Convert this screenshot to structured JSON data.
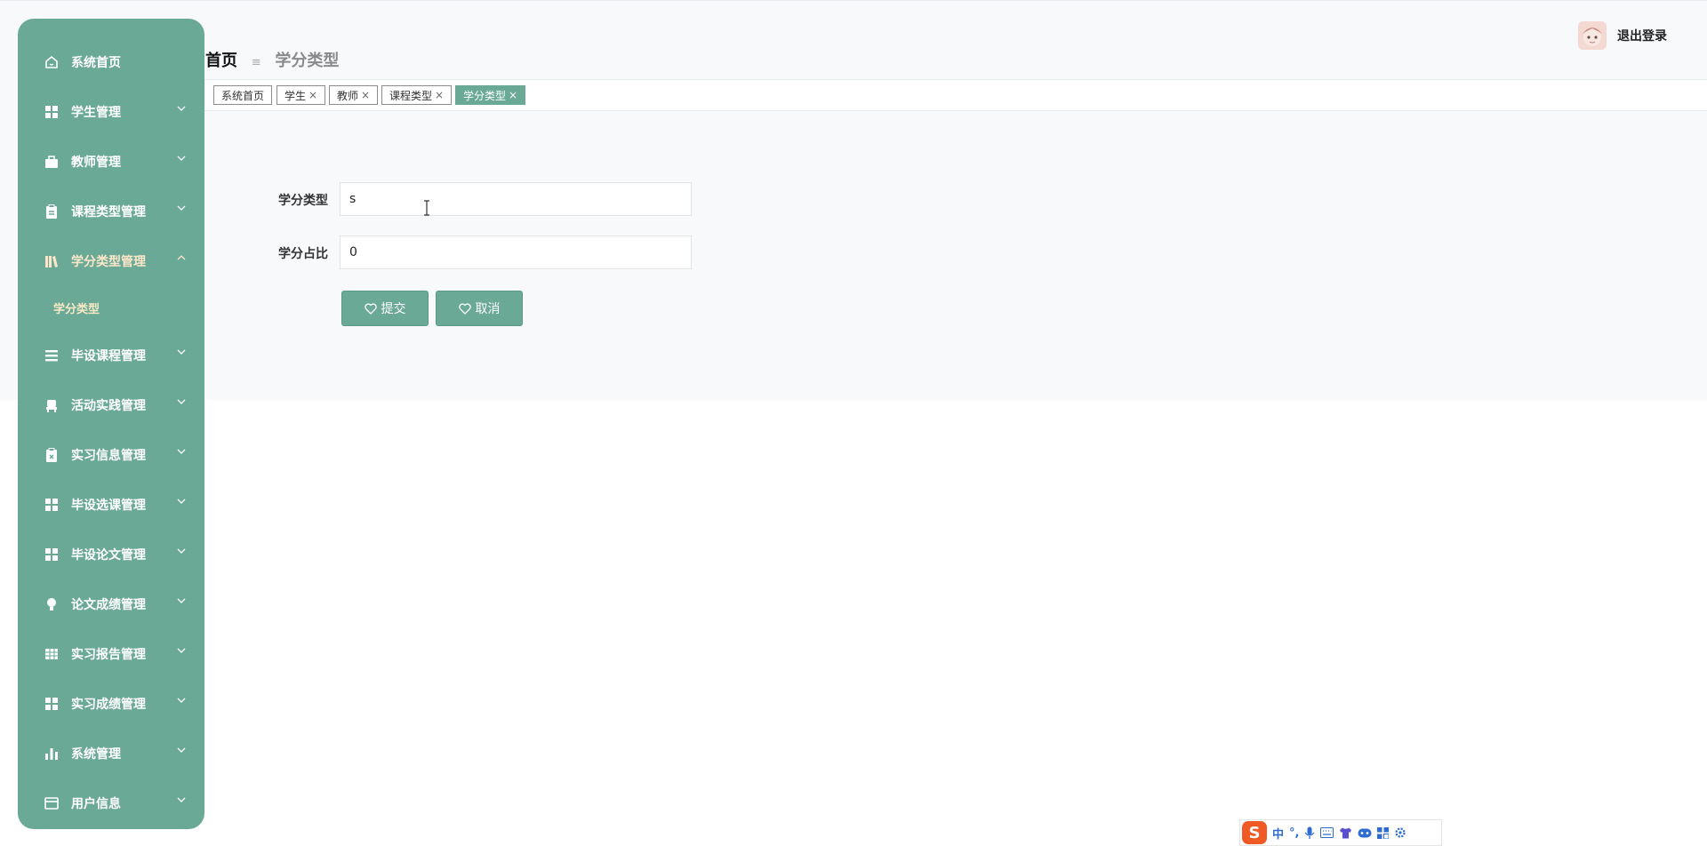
{
  "app": {
    "breadcrumb": {
      "home": "首页",
      "current": "学分类型"
    },
    "logout_label": "退出登录"
  },
  "sidebar": {
    "items": [
      {
        "label": "系统首页",
        "icon": "home-icon"
      },
      {
        "label": "学生管理",
        "icon": "grid-icon"
      },
      {
        "label": "教师管理",
        "icon": "briefcase-icon"
      },
      {
        "label": "课程类型管理",
        "icon": "clipboard-icon"
      },
      {
        "label": "学分类型管理",
        "icon": "books-icon",
        "expanded": true
      },
      {
        "label": "毕设课程管理",
        "icon": "list-icon"
      },
      {
        "label": "活动实践管理",
        "icon": "chair-icon"
      },
      {
        "label": "实习信息管理",
        "icon": "clipboard-x-icon"
      },
      {
        "label": "毕设选课管理",
        "icon": "grid-icon"
      },
      {
        "label": "毕设论文管理",
        "icon": "grid-icon"
      },
      {
        "label": "论文成绩管理",
        "icon": "bulb-icon"
      },
      {
        "label": "实习报告管理",
        "icon": "table-icon"
      },
      {
        "label": "实习成绩管理",
        "icon": "grid-icon"
      },
      {
        "label": "系统管理",
        "icon": "bar-chart-icon"
      },
      {
        "label": "用户信息",
        "icon": "card-icon"
      }
    ],
    "submenu": [
      {
        "label": "学分类型"
      }
    ]
  },
  "tabs": [
    {
      "label": "系统首页",
      "closable": false
    },
    {
      "label": "学生",
      "closable": true
    },
    {
      "label": "教师",
      "closable": true
    },
    {
      "label": "课程类型",
      "closable": true
    },
    {
      "label": "学分类型",
      "closable": true,
      "active": true
    }
  ],
  "tab_close_glyph": "×",
  "form": {
    "credit_type": {
      "label": "学分类型",
      "value": "s"
    },
    "credit_ratio": {
      "label": "学分占比",
      "value": "0"
    },
    "submit_label": "提交",
    "cancel_label": "取消"
  },
  "ime_toolbar": {
    "logo": "S",
    "items": [
      "中",
      "°,",
      "mic-icon",
      "keyboard-icon",
      "shirt-icon",
      "gamepad-icon",
      "apps-icon",
      "settings-icon"
    ]
  },
  "colors": {
    "accent": "#6aa996",
    "active_menu_text": "#fce6c9",
    "ime_logo": "#f05a24"
  }
}
